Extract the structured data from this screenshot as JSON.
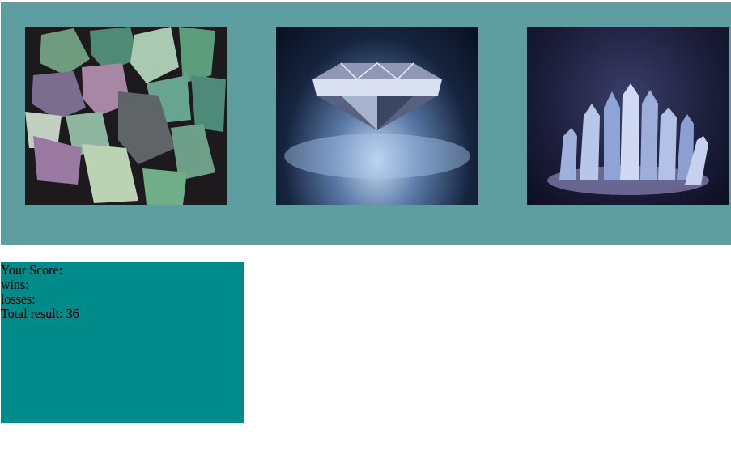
{
  "crystals": [
    {
      "kind": "fluorite"
    },
    {
      "kind": "diamond"
    },
    {
      "kind": "cluster"
    }
  ],
  "scoreboard": {
    "score_label": "Your Score:",
    "wins_label": "wins:",
    "losses_label": "losses:",
    "total_label": "Total result: 36"
  }
}
